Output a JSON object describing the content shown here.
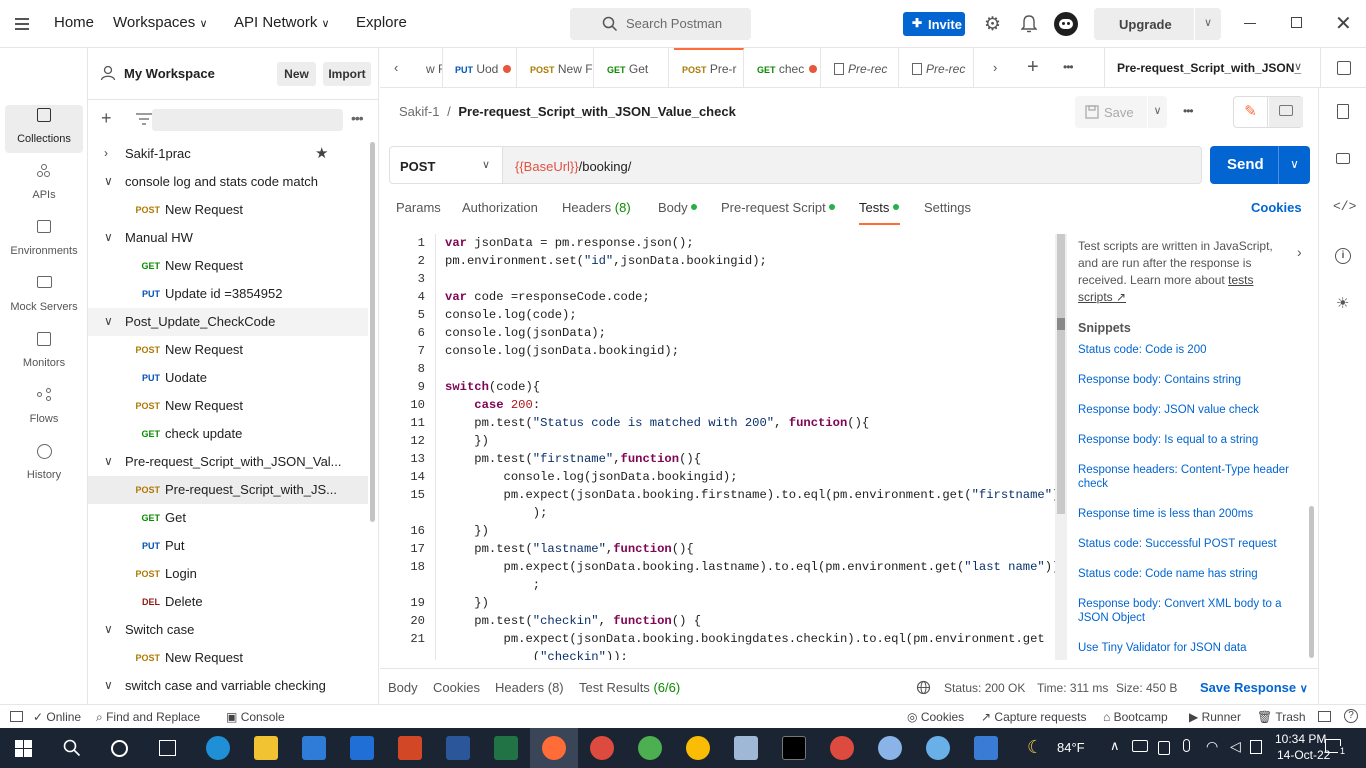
{
  "topbar": {
    "home": "Home",
    "workspaces": "Workspaces",
    "api_network": "API Network",
    "explore": "Explore",
    "search_placeholder": "Search Postman",
    "invite": "Invite",
    "upgrade": "Upgrade"
  },
  "leftnav": [
    {
      "label": "Collections",
      "icon": "collections-icon"
    },
    {
      "label": "APIs",
      "icon": "apis-icon"
    },
    {
      "label": "Environments",
      "icon": "environments-icon"
    },
    {
      "label": "Mock Servers",
      "icon": "mock-servers-icon"
    },
    {
      "label": "Monitors",
      "icon": "monitors-icon"
    },
    {
      "label": "Flows",
      "icon": "flows-icon"
    },
    {
      "label": "History",
      "icon": "history-icon"
    }
  ],
  "sidebar": {
    "workspace": "My Workspace",
    "new": "New",
    "import": "Import",
    "tree": [
      {
        "type": "folder",
        "label": "Sakif-1prac",
        "expanded": false,
        "starred": true
      },
      {
        "type": "folder",
        "label": "console log and stats code match",
        "expanded": true
      },
      {
        "type": "req",
        "method": "POST",
        "label": "New Request"
      },
      {
        "type": "folder",
        "label": "Manual HW",
        "expanded": true
      },
      {
        "type": "req",
        "method": "GET",
        "label": "New Request"
      },
      {
        "type": "req",
        "method": "PUT",
        "label": "Update id =3854952"
      },
      {
        "type": "folder",
        "label": "Post_Update_CheckCode",
        "expanded": true
      },
      {
        "type": "req",
        "method": "POST",
        "label": "New Request"
      },
      {
        "type": "req",
        "method": "PUT",
        "label": "Uodate"
      },
      {
        "type": "req",
        "method": "POST",
        "label": "New Request"
      },
      {
        "type": "req",
        "method": "GET",
        "label": "check update"
      },
      {
        "type": "folder",
        "label": "Pre-request_Script_with_JSON_Val...",
        "expanded": true
      },
      {
        "type": "req",
        "method": "POST",
        "label": "Pre-request_Script_with_JS...",
        "selected": true
      },
      {
        "type": "req",
        "method": "GET",
        "label": "Get"
      },
      {
        "type": "req",
        "method": "PUT",
        "label": "Put"
      },
      {
        "type": "req",
        "method": "POST",
        "label": "Login"
      },
      {
        "type": "req",
        "method": "DEL",
        "label": "Delete"
      },
      {
        "type": "folder",
        "label": "Switch case",
        "expanded": true
      },
      {
        "type": "req",
        "method": "POST",
        "label": "New Request"
      },
      {
        "type": "folder",
        "label": "switch case and varriable checking",
        "expanded": true
      }
    ]
  },
  "tabs": [
    {
      "method": "",
      "label": "w F"
    },
    {
      "method": "PUT",
      "label": "Uod",
      "dot": true
    },
    {
      "method": "POST",
      "label": "New F"
    },
    {
      "method": "GET",
      "label": "Get"
    },
    {
      "method": "POST",
      "label": "Pre-r",
      "active": true
    },
    {
      "method": "GET",
      "label": "chec",
      "dot": true
    },
    {
      "method": "",
      "label": "Pre-rec"
    },
    {
      "method": "",
      "label": "Pre-rec"
    }
  ],
  "env_select": "Pre-request_Script_with_JSON_",
  "request": {
    "breadcrumb_parent": "Sakif-1",
    "breadcrumb_sep": "/",
    "title": "Pre-request_Script_with_JSON_Value_check",
    "save": "Save",
    "method": "POST",
    "url_var": "{{BaseUrl}}",
    "url_path": "/booking/",
    "send": "Send"
  },
  "subtabs": {
    "params": "Params",
    "authorization": "Authorization",
    "headers": "Headers",
    "headers_count": "(8)",
    "body": "Body",
    "prerequest": "Pre-request Script",
    "tests": "Tests",
    "settings": "Settings",
    "cookies": "Cookies"
  },
  "code_lines": [
    {
      "n": "1",
      "text": "var jsonData = pm.response.json();"
    },
    {
      "n": "2",
      "text": "pm.environment.set(\"id\",jsonData.bookingid);"
    },
    {
      "n": "3",
      "text": ""
    },
    {
      "n": "4",
      "text": "var code =responseCode.code;"
    },
    {
      "n": "5",
      "text": "console.log(code);"
    },
    {
      "n": "6",
      "text": "console.log(jsonData);"
    },
    {
      "n": "7",
      "text": "console.log(jsonData.bookingid);"
    },
    {
      "n": "8",
      "text": ""
    },
    {
      "n": "9",
      "text": "switch(code){"
    },
    {
      "n": "10",
      "text": "    case 200:"
    },
    {
      "n": "11",
      "text": "    pm.test(\"Status code is matched with 200\", function(){"
    },
    {
      "n": "12",
      "text": "    })"
    },
    {
      "n": "13",
      "text": "    pm.test(\"firstname\",function(){"
    },
    {
      "n": "14",
      "text": "        console.log(jsonData.bookingid);"
    },
    {
      "n": "15",
      "text": "        pm.expect(jsonData.booking.firstname).to.eql(pm.environment.get(\"firstname\")"
    },
    {
      "n": "",
      "text": "            );"
    },
    {
      "n": "16",
      "text": "    })"
    },
    {
      "n": "17",
      "text": "    pm.test(\"lastname\",function(){"
    },
    {
      "n": "18",
      "text": "        pm.expect(jsonData.booking.lastname).to.eql(pm.environment.get(\"last name\"))"
    },
    {
      "n": "",
      "text": "            ;"
    },
    {
      "n": "19",
      "text": "    })"
    },
    {
      "n": "20",
      "text": "    pm.test(\"checkin\", function() {"
    },
    {
      "n": "21",
      "text": "        pm.expect(jsonData.booking.bookingdates.checkin).to.eql(pm.environment.get"
    },
    {
      "n": "",
      "text": "            (\"checkin\"));"
    }
  ],
  "right_panel": {
    "info": "Test scripts are written in JavaScript, and are run after the response is received. Learn more about",
    "info_link": "tests scripts ↗",
    "snippets_title": "Snippets",
    "snippets": [
      "Status code: Code is 200",
      "Response body: Contains string",
      "Response body: JSON value check",
      "Response body: Is equal to a string",
      "Response headers: Content-Type header check",
      "Response time is less than 200ms",
      "Status code: Successful POST request",
      "Status code: Code name has string",
      "Response body: Convert XML body to a JSON Object",
      "Use Tiny Validator for JSON data"
    ]
  },
  "response_bar": {
    "body": "Body",
    "cookies": "Cookies",
    "headers": "Headers (8)",
    "test_results": "Test Results",
    "test_count": "(6/6)",
    "status": "Status: 200 OK",
    "time": "Time: 311 ms",
    "size": "Size: 450 B",
    "save_response": "Save Response"
  },
  "statusbar": {
    "online": "Online",
    "find_replace": "Find and Replace",
    "console": "Console",
    "cookies": "Cookies",
    "capture": "Capture requests",
    "bootcamp": "Bootcamp",
    "runner": "Runner",
    "trash": "Trash"
  },
  "taskbar": {
    "weather": "84°F",
    "time": "10:34 PM",
    "date": "14-Oct-22",
    "notifications": "1"
  },
  "colors": {
    "accent": "#0265d2",
    "active_tab": "#ff6c37",
    "dot": "#26b047",
    "taskbar": "#1a2433"
  }
}
